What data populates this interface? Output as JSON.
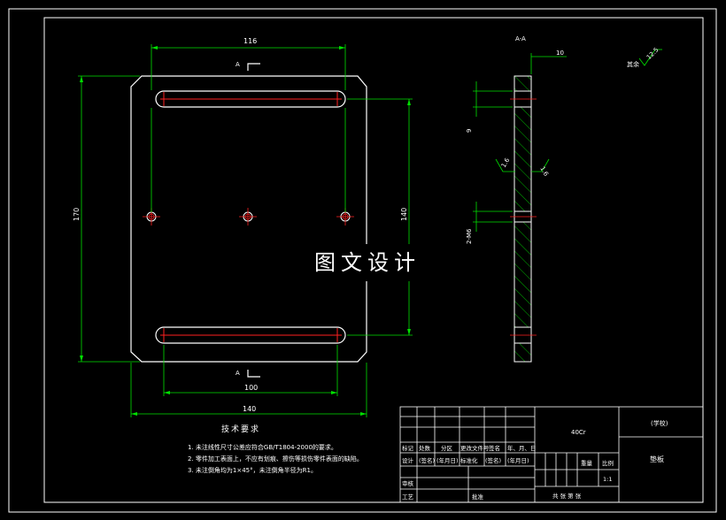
{
  "watermark": "图文设计",
  "front_view": {
    "dim_top": "116",
    "dim_bottom_inner": "100",
    "dim_bottom_outer": "140",
    "dim_left": "170",
    "dim_right": "140",
    "section_mark_top": "A",
    "section_mark_bottom": "A"
  },
  "section_view": {
    "label": "A-A",
    "dim_thickness": "10",
    "dim_9": "9",
    "dim_holes": "2-M6",
    "roughness_left": "1.6",
    "roughness_right": "1.6"
  },
  "surface_finish": {
    "label": "其余",
    "value": "12.5"
  },
  "tech_requirements": {
    "title": "技术要求",
    "lines": [
      "1. 未注线性尺寸公差应符合GB/T1804-2000的要求。",
      "2. 零件加工表面上，不应有划痕、擦伤等损伤零件表面的缺陷。",
      "3. 未注倒角均为1×45°，未注倒角半径为R1。"
    ]
  },
  "title_block": {
    "material": "40Cr",
    "school": "(学校)",
    "part_name": "垫板",
    "labels_row1": [
      "标记",
      "处数",
      "分区",
      "更改文件号",
      "签名",
      "年、月、日"
    ],
    "labels_row2": [
      "设计",
      "(签名)",
      "(年月日)",
      "标准化",
      "(签名)",
      "(年月日)"
    ],
    "audit": "审核",
    "process": "工艺",
    "approve": "批准",
    "weight": "重量",
    "scale": "比例",
    "scale_value": "1:1",
    "sheets": "共  张  第  张"
  }
}
